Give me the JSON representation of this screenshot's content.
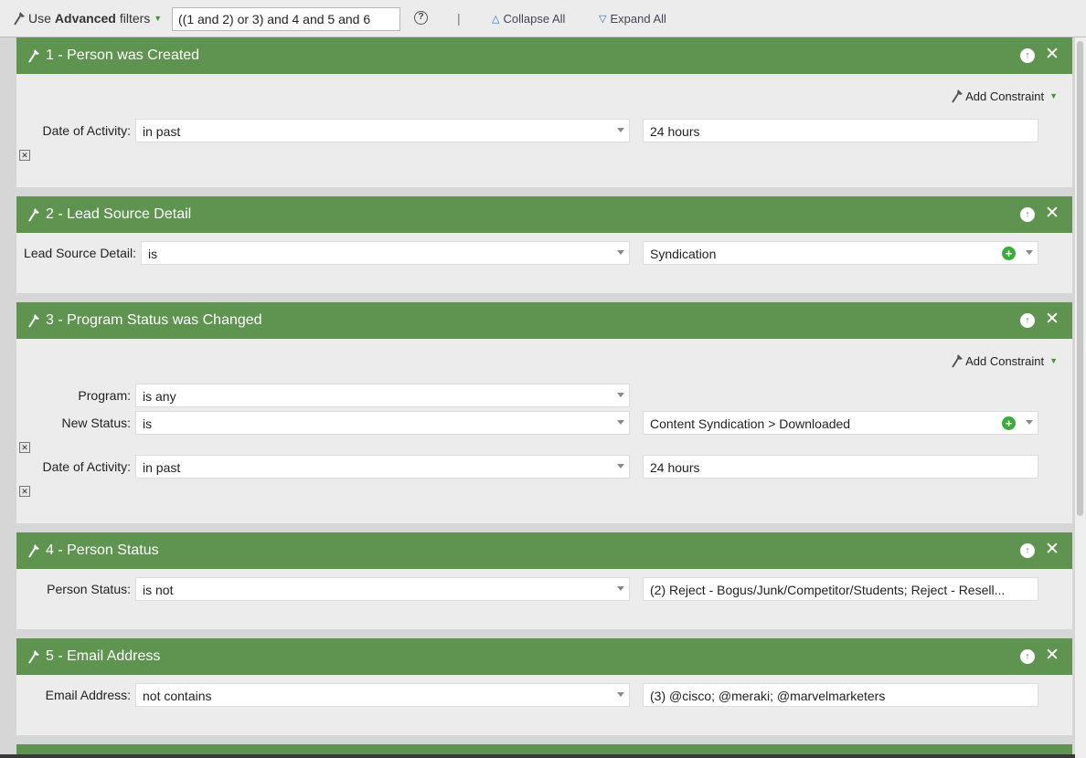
{
  "toolbar": {
    "use_label": "Use",
    "advanced_label": "Advanced",
    "filters_label": "filters",
    "filter_logic": "((1 and 2) or 3) and 4 and 5 and 6",
    "help": "?",
    "separator": "|",
    "collapse_all": "Collapse All",
    "expand_all": "Expand All"
  },
  "panels": [
    {
      "title": "1 - Person was Created",
      "add_constraint": "Add Constraint",
      "rows": [
        {
          "label": "Date of Activity:",
          "operator": "in past",
          "value": "24 hours"
        }
      ]
    },
    {
      "title": "2 - Lead Source Detail",
      "rows": [
        {
          "label": "Lead Source Detail:",
          "operator": "is",
          "value": "Syndication"
        }
      ]
    },
    {
      "title": "3 - Program Status was Changed",
      "add_constraint": "Add Constraint",
      "rows": [
        {
          "label": "Program:",
          "operator": "is any"
        },
        {
          "label": "New Status:",
          "operator": "is",
          "value": "Content Syndication > Downloaded"
        },
        {
          "label": "Date of Activity:",
          "operator": "in past",
          "value": "24 hours"
        }
      ]
    },
    {
      "title": "4 - Person Status",
      "rows": [
        {
          "label": "Person Status:",
          "operator": "is not",
          "value": "(2) Reject - Bogus/Junk/Competitor/Students; Reject - Resell..."
        }
      ]
    },
    {
      "title": "5 - Email Address",
      "rows": [
        {
          "label": "Email Address:",
          "operator": "not contains",
          "value": "(3) @cisco; @meraki; @marvelmarketers"
        }
      ]
    }
  ],
  "colors": {
    "panel_header": "#5f9450",
    "panel_body": "#ececec",
    "plus_green": "#3cab3c"
  }
}
